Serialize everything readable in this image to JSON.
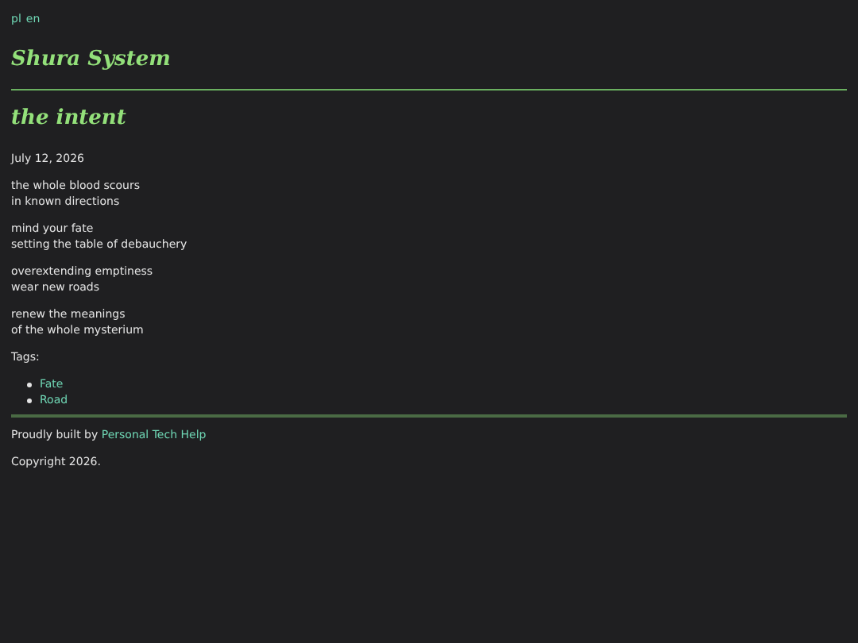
{
  "languages": [
    "pl",
    "en"
  ],
  "site_title": "Shura System",
  "post": {
    "title": "the intent",
    "date": "July 12, 2026",
    "stanzas": [
      [
        "the whole blood scours",
        "in known directions"
      ],
      [
        "mind your fate",
        "setting the table of debauchery"
      ],
      [
        "overextending emptiness",
        "wear new roads"
      ],
      [
        "renew the meanings",
        "of the whole mysterium"
      ]
    ],
    "tags_label": "Tags:",
    "tags": [
      "Fate",
      "Road"
    ]
  },
  "footer": {
    "built_by": "Proudly built by",
    "link": "Personal Tech Help",
    "copyright": "Copyright 2026."
  }
}
